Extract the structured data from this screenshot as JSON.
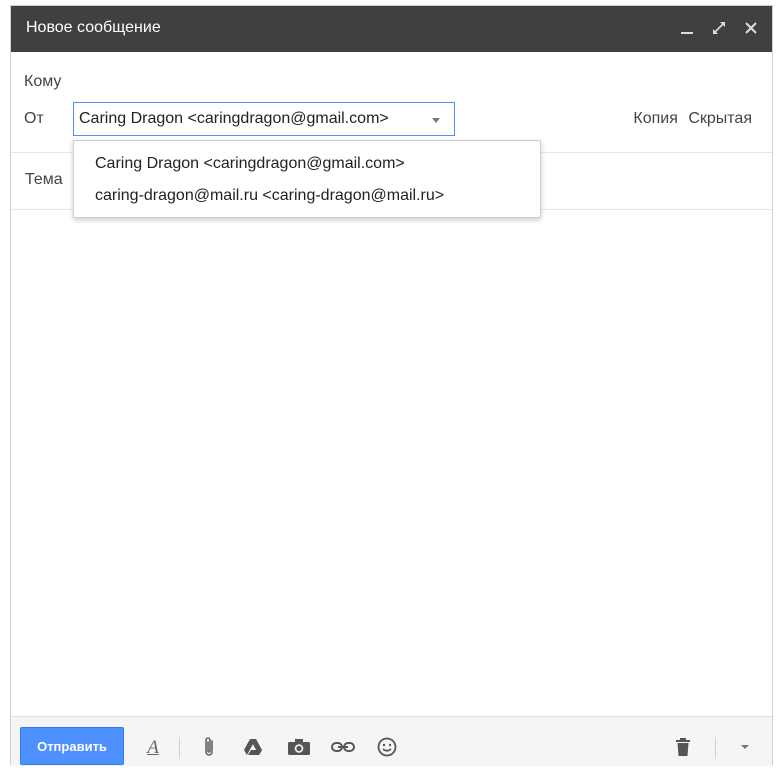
{
  "window": {
    "title": "Новое сообщение",
    "controls": [
      "minimize-icon",
      "expand-icon",
      "close-icon"
    ]
  },
  "fields": {
    "to_label": "Кому",
    "from_label": "От",
    "from_value": "Caring Dragon <caringdragon@gmail.com>",
    "cc_label": "Копия",
    "bcc_label": "Скрытая",
    "subject_label": "Тема"
  },
  "from_options": [
    "Caring Dragon <caringdragon@gmail.com>",
    "caring-dragon@mail.ru <caring-dragon@mail.ru>"
  ],
  "toolbar": {
    "send_label": "Отправить",
    "tools": [
      "format-text-icon",
      "attach-icon",
      "drive-icon",
      "photo-icon",
      "link-icon",
      "emoji-icon",
      "trash-icon",
      "more-options-icon"
    ]
  },
  "colors": {
    "titlebar": "#404040",
    "send_button": "#4d90fe",
    "focus_border": "#4d90fe"
  }
}
